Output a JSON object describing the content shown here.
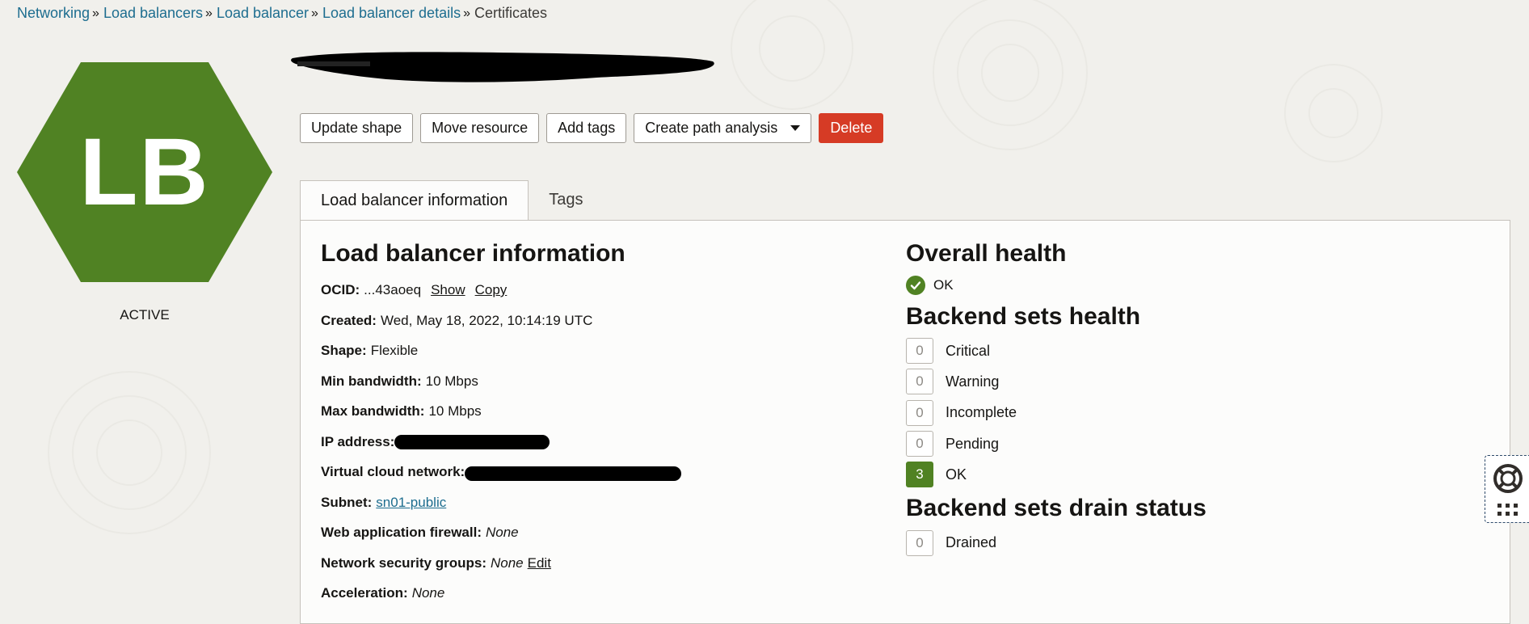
{
  "breadcrumb": {
    "items": [
      "Networking",
      "Load balancers",
      "Load balancer",
      "Load balancer details"
    ],
    "current": "Certificates",
    "separator": "»"
  },
  "resource": {
    "logo_text": "LB",
    "status": "ACTIVE",
    "logo_color": "#508223"
  },
  "actions": {
    "update_shape": "Update shape",
    "move_resource": "Move resource",
    "add_tags": "Add tags",
    "create_path_analysis": "Create path analysis",
    "delete": "Delete"
  },
  "tabs": [
    {
      "label": "Load balancer information",
      "active": true
    },
    {
      "label": "Tags",
      "active": false
    }
  ],
  "info": {
    "heading": "Load balancer information",
    "ocid": {
      "label": "OCID:",
      "value": "...43aoeq",
      "show": "Show",
      "copy": "Copy"
    },
    "created": {
      "label": "Created:",
      "value": "Wed, May 18, 2022, 10:14:19 UTC"
    },
    "shape": {
      "label": "Shape:",
      "value": "Flexible"
    },
    "min_bandwidth": {
      "label": "Min bandwidth:",
      "value": "10 Mbps"
    },
    "max_bandwidth": {
      "label": "Max bandwidth:",
      "value": "10 Mbps"
    },
    "ip_address": {
      "label": "IP address:"
    },
    "vcn": {
      "label": "Virtual cloud network:"
    },
    "subnet": {
      "label": "Subnet:",
      "value": "sn01-public"
    },
    "waf": {
      "label": "Web application firewall:",
      "value": "None"
    },
    "nsg": {
      "label": "Network security groups:",
      "value": "None",
      "edit": "Edit"
    },
    "acceleration": {
      "label": "Acceleration:",
      "value": "None"
    }
  },
  "health": {
    "overall_heading": "Overall health",
    "overall_status": "OK",
    "backend_heading": "Backend sets health",
    "backend": [
      {
        "count": "0",
        "label": "Critical"
      },
      {
        "count": "0",
        "label": "Warning"
      },
      {
        "count": "0",
        "label": "Incomplete"
      },
      {
        "count": "0",
        "label": "Pending"
      },
      {
        "count": "3",
        "label": "OK"
      }
    ],
    "drain_heading": "Backend sets drain status",
    "drain": [
      {
        "count": "0",
        "label": "Drained"
      }
    ]
  },
  "icons": {
    "check": "check-icon",
    "help": "lifebuoy-icon",
    "grid": "apps-grid-icon",
    "dropdown": "chevron-down-icon"
  }
}
